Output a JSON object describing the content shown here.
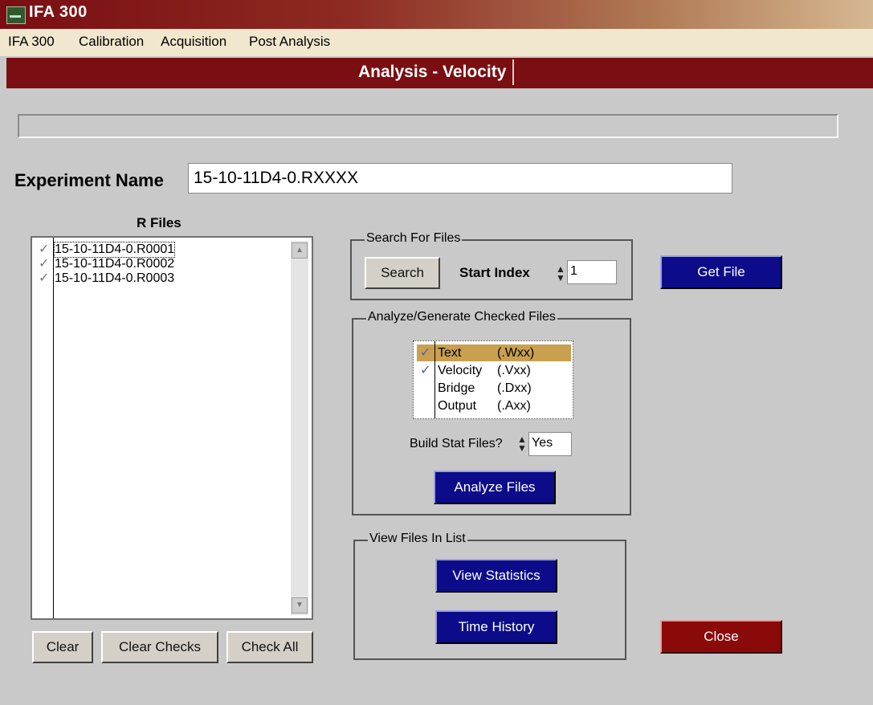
{
  "window": {
    "title": "IFA 300"
  },
  "menu": [
    "IFA 300",
    "Calibration",
    "Acquisition",
    "Post Analysis"
  ],
  "header": {
    "title": "Analysis - Velocity"
  },
  "progress": {
    "value": 0
  },
  "experiment": {
    "label": "Experiment Name",
    "value": "15-10-11D4-0.RXXXX"
  },
  "rfiles": {
    "label": "R Files",
    "items": [
      {
        "name": "15-10-11D4-0.R0001",
        "checked": true,
        "check_mark": "✓"
      },
      {
        "name": "15-10-11D4-0.R0002",
        "checked": true,
        "check_mark": "✓"
      },
      {
        "name": "15-10-11D4-0.R0003",
        "checked": true,
        "check_mark": "✓"
      }
    ],
    "buttons": {
      "clear": "Clear",
      "clear_checks": "Clear Checks",
      "check_all": "Check All"
    }
  },
  "search_group": {
    "legend": "Search For Files",
    "search_button": "Search",
    "start_index_label": "Start Index",
    "start_index_value": "1"
  },
  "get_file_button": "Get File",
  "analyze_group": {
    "legend": "Analyze/Generate Checked Files",
    "options": [
      {
        "name": "Text",
        "ext": "(.Wxx)",
        "checked": true,
        "check_mark": "✓"
      },
      {
        "name": "Velocity",
        "ext": "(.Vxx)",
        "checked": true,
        "check_mark": "✓"
      },
      {
        "name": "Bridge",
        "ext": "(.Dxx)",
        "checked": false,
        "check_mark": ""
      },
      {
        "name": "Output",
        "ext": "(.Axx)",
        "checked": false,
        "check_mark": ""
      }
    ],
    "build_stat_label": "Build Stat Files?",
    "build_stat_value": "Yes",
    "analyze_button": "Analyze Files"
  },
  "view_group": {
    "legend": "View Files In List",
    "view_stats_button": "View Statistics",
    "time_history_button": "Time History"
  },
  "close_button": "Close",
  "colors": {
    "title_red": "#7a0e12",
    "menu_bg": "#f1e7cf",
    "button_blue": "#0c0c8a",
    "button_red": "#8a0a0a",
    "highlight": "#c8a050",
    "window_bg": "#c9c9c9"
  }
}
